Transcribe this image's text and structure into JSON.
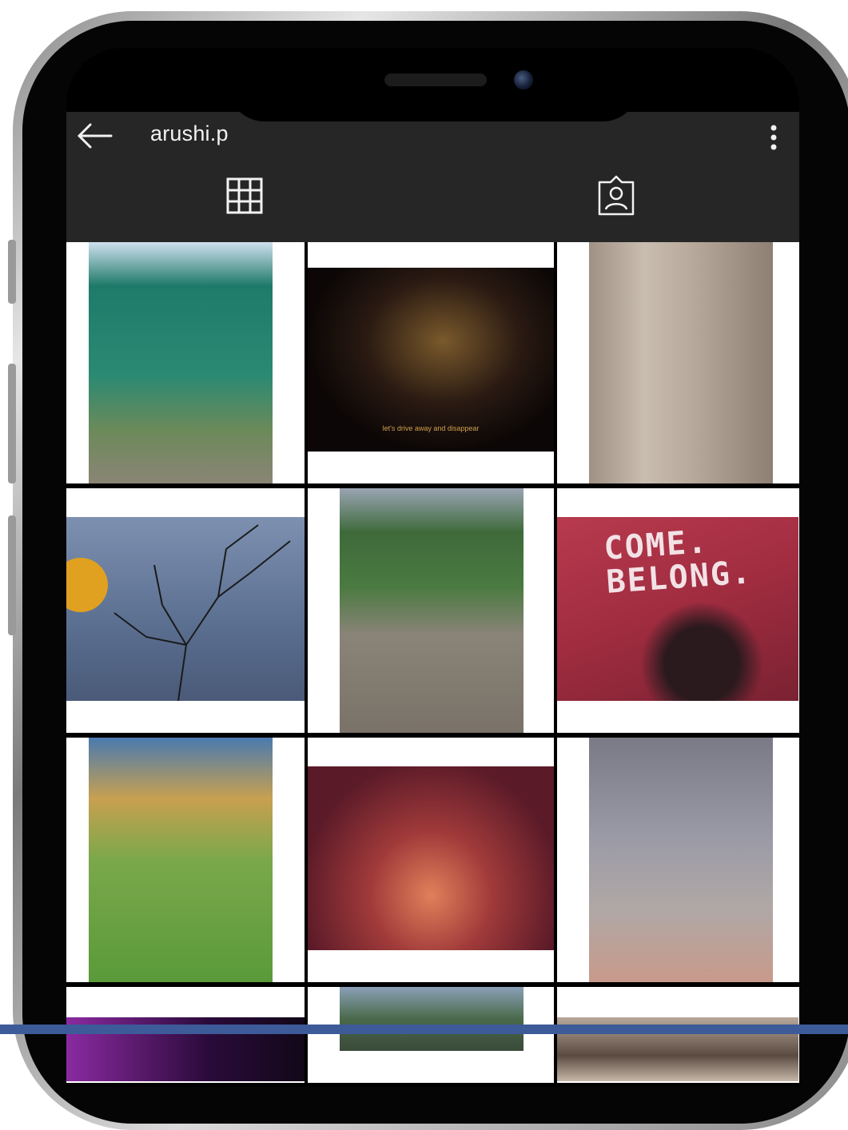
{
  "profile": {
    "username": "arushi.p"
  },
  "icons": {
    "back": "back-arrow-icon",
    "more": "more-vertical-icon",
    "grid_tab": "grid-icon",
    "tagged_tab": "tagged-person-icon"
  },
  "posts": [
    {
      "caption": ""
    },
    {
      "caption": "let's drive away and disappear"
    },
    {
      "caption": ""
    },
    {
      "caption": ""
    },
    {
      "caption": ""
    },
    {
      "caption": "COME. BELONG."
    },
    {
      "caption": ""
    },
    {
      "caption": ""
    },
    {
      "caption": ""
    },
    {
      "caption": ""
    },
    {
      "caption": ""
    },
    {
      "caption": ""
    }
  ],
  "colors": {
    "header_bg": "#262626",
    "accent_band": "#3d5a99"
  }
}
